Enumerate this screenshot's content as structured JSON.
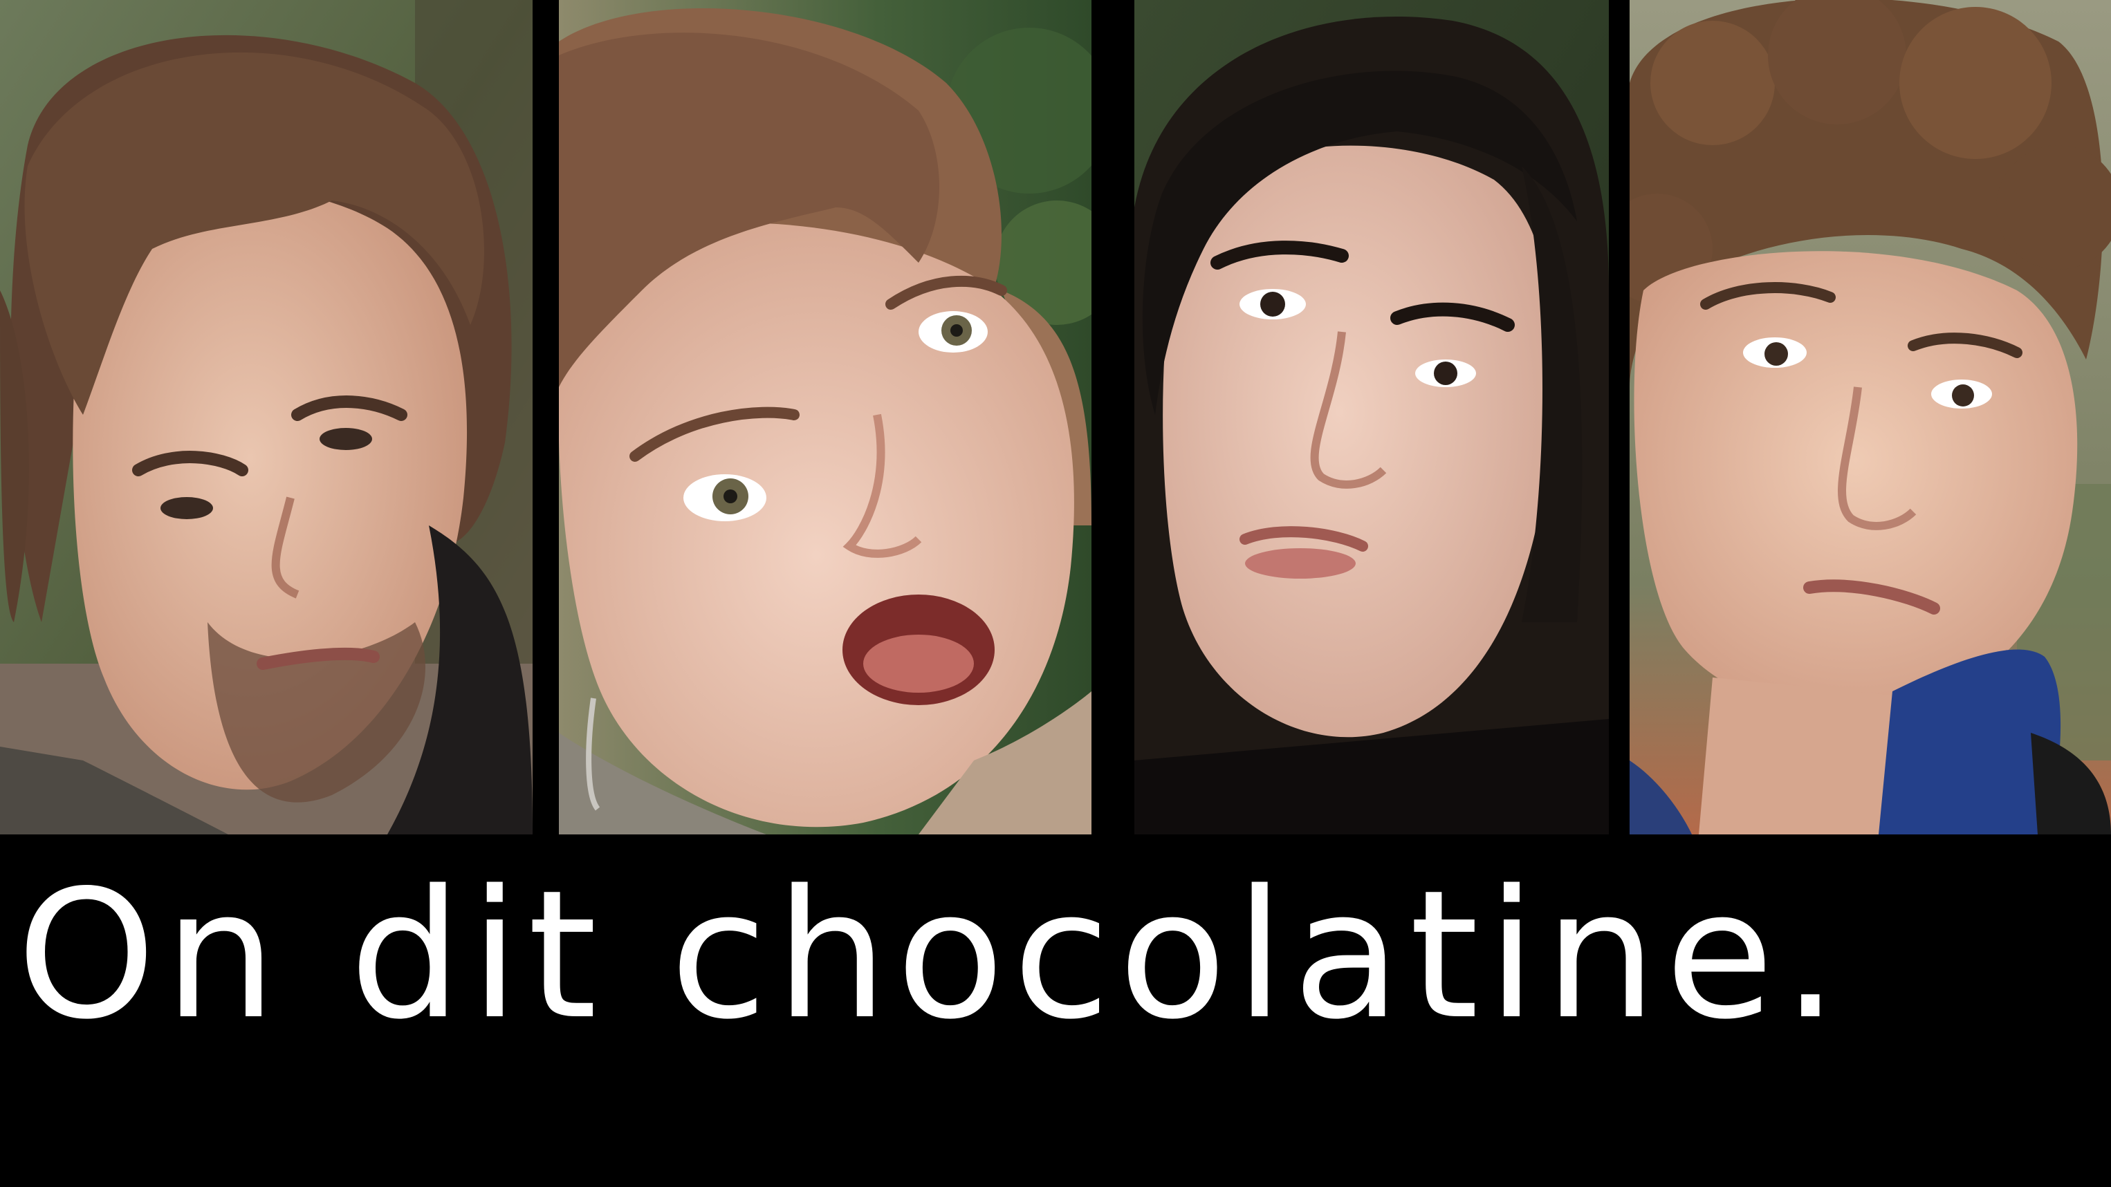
{
  "title": {
    "text": "On dit chocolatine."
  },
  "colors": {
    "background": "#000000",
    "title_text": "#ffffff",
    "foliage": "#4c5e3c",
    "skin": "#e6c0a8",
    "hair_brown": "#5a3f2c",
    "hair_dark": "#1c1612"
  },
  "panels": [
    {
      "name": "portrait-young-man-long-hair"
    },
    {
      "name": "portrait-young-woman-bangs"
    },
    {
      "name": "portrait-young-woman-dark-hair"
    },
    {
      "name": "portrait-young-man-curly-hair"
    }
  ]
}
